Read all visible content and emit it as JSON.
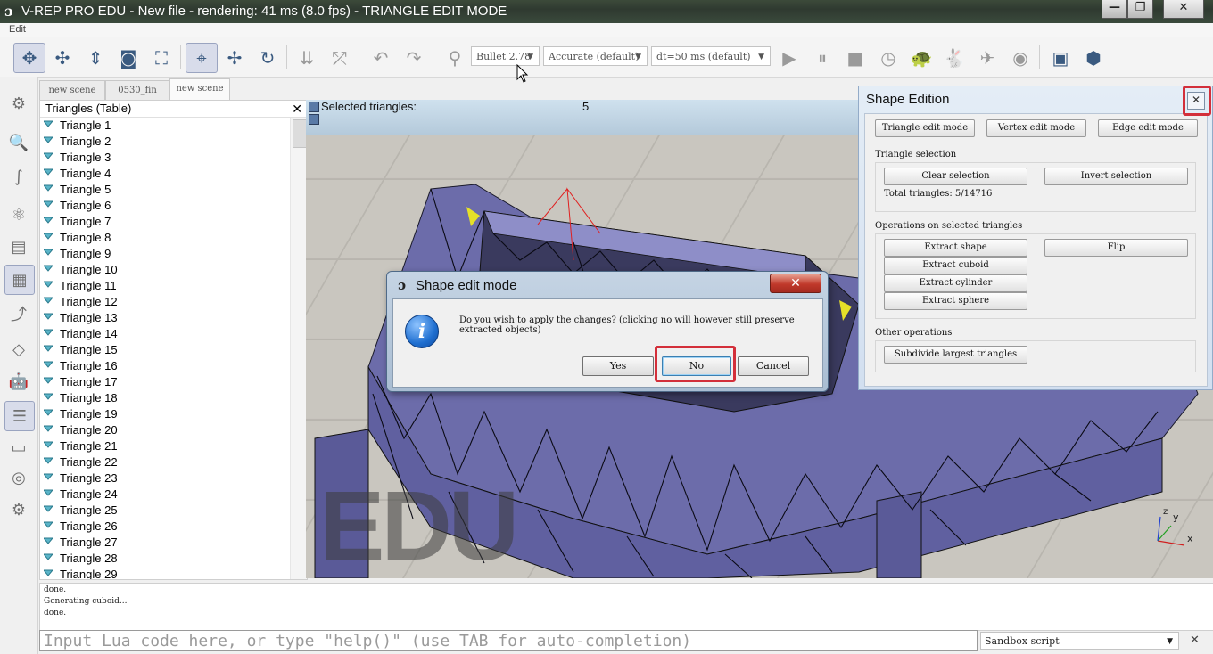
{
  "window": {
    "logo": "ɔ",
    "title": "V-REP PRO EDU - New file - rendering: 41 ms (8.0 fps) - TRIANGLE EDIT MODE",
    "minimize_glyph": "—",
    "maximize_glyph": "❐",
    "close_glyph": "✕"
  },
  "menu": {
    "edit": "Edit"
  },
  "toolbar": {
    "engine_combo": "Bullet 2.78",
    "accuracy_combo": "Accurate (default)",
    "dt_combo": "dt=50 ms (default)",
    "dropdown_arrow": "▼",
    "icons": {
      "move": "✥",
      "camera_shift": "✣",
      "camera_zoom": "⇕",
      "screenshot": "◙",
      "fit_view": "⛶",
      "click_select": "⌖",
      "object_shift": "✢",
      "object_rotate": "↻",
      "assemble": "⇊",
      "transfer_dna": "⤱",
      "undo": "↶",
      "redo": "↷",
      "engine": "⚲",
      "play": "▶",
      "pause": "⏸",
      "stop": "■",
      "realtime": "◷",
      "slow": "🐢",
      "fast": "🐇",
      "threaded": "✈",
      "visualize": "◉",
      "page_selector": "▣",
      "scene_selector": "⬢"
    }
  },
  "left_toolbar": [
    "⚙",
    "🔍",
    "∫",
    "⚛",
    "▤",
    "▦",
    "⤴",
    "◇",
    "🤖",
    "☰",
    "▭",
    "◎",
    "⚙"
  ],
  "tabs": [
    "new scene",
    "0530_fin",
    "new scene"
  ],
  "hierarchy": {
    "title": "Triangles (Table)",
    "close_glyph": "✕",
    "items": [
      "Triangle 1",
      "Triangle 2",
      "Triangle 3",
      "Triangle 4",
      "Triangle 5",
      "Triangle 6",
      "Triangle 7",
      "Triangle 8",
      "Triangle 9",
      "Triangle 10",
      "Triangle 11",
      "Triangle 12",
      "Triangle 13",
      "Triangle 14",
      "Triangle 15",
      "Triangle 16",
      "Triangle 17",
      "Triangle 18",
      "Triangle 19",
      "Triangle 20",
      "Triangle 21",
      "Triangle 22",
      "Triangle 23",
      "Triangle 24",
      "Triangle 25",
      "Triangle 26",
      "Triangle 27",
      "Triangle 28",
      "Triangle 29"
    ]
  },
  "viewport": {
    "selected_label": "Selected triangles:",
    "selected_count": "5",
    "watermark": "EDU",
    "axis_labels": {
      "x": "x",
      "y": "y",
      "z": "z"
    }
  },
  "dialog": {
    "title": "Shape edit mode",
    "message": "Do you wish to apply the changes? (clicking no will however still preserve extracted objects)",
    "info_glyph": "i",
    "close_glyph": "✕",
    "yes": "Yes",
    "no": "No",
    "cancel": "Cancel"
  },
  "shape_edition": {
    "title": "Shape Edition",
    "close_glyph": "✕",
    "mode_buttons": [
      "Triangle edit mode",
      "Vertex edit mode",
      "Edge edit mode"
    ],
    "triangle_selection_label": "Triangle selection",
    "clear_selection": "Clear selection",
    "invert_selection": "Invert selection",
    "total_triangles": "Total triangles: 5/14716",
    "operations_label": "Operations on selected triangles",
    "extract_shape": "Extract shape",
    "flip": "Flip",
    "extract_cuboid": "Extract cuboid",
    "extract_cylinder": "Extract cylinder",
    "extract_sphere": "Extract sphere",
    "other_label": "Other operations",
    "subdivide": "Subdivide largest triangles"
  },
  "console": {
    "lines": [
      "done.",
      "Generating cuboid...",
      "done."
    ],
    "lua_placeholder": "Input Lua code here, or type \"help()\" (use TAB for auto-completion)",
    "script_combo": "Sandbox script",
    "close_glyph": "✕"
  },
  "colors": {
    "highlight": "#d32f3a",
    "mesh": "#6c6caa",
    "selected_triangle": "#e6e028"
  }
}
